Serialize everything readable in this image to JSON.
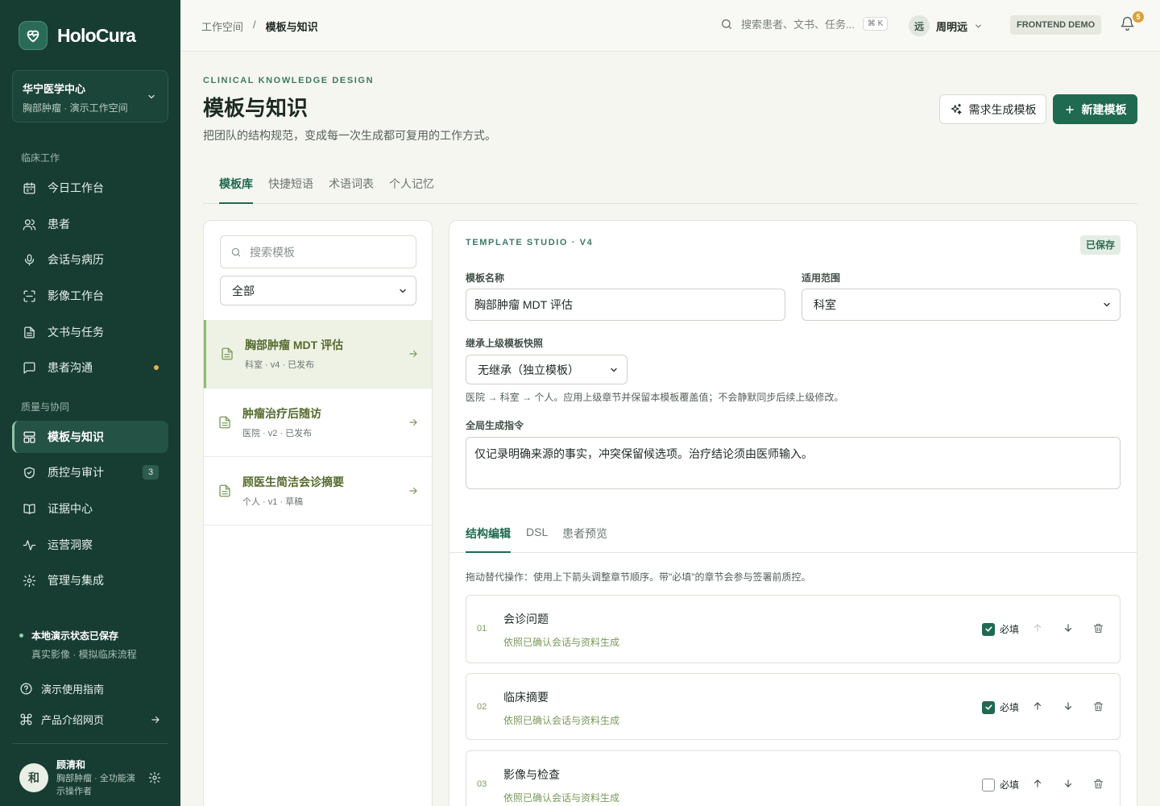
{
  "brand": {
    "name": "HoloCura"
  },
  "org": {
    "name": "华宁医学中心",
    "workspace": "胸部肿瘤 · 演示工作空间"
  },
  "nav": {
    "section_clinical": "临床工作",
    "section_quality": "质量与协同",
    "items": [
      {
        "label": "今日工作台",
        "icon": "calendar-icon"
      },
      {
        "label": "患者",
        "icon": "users-icon"
      },
      {
        "label": "会话与病历",
        "icon": "mic-icon"
      },
      {
        "label": "影像工作台",
        "icon": "scan-icon"
      },
      {
        "label": "文书与任务",
        "icon": "document-icon"
      },
      {
        "label": "患者沟通",
        "icon": "chat-icon",
        "dot": true
      },
      {
        "label": "模板与知识",
        "icon": "layout-icon",
        "active": true
      },
      {
        "label": "质控与审计",
        "icon": "shield-icon",
        "count": "3"
      },
      {
        "label": "证据中心",
        "icon": "book-icon"
      },
      {
        "label": "运营洞察",
        "icon": "activity-icon"
      },
      {
        "label": "管理与集成",
        "icon": "gear-icon"
      }
    ]
  },
  "status": {
    "title": "本地演示状态已保存",
    "sub": "真实影像 · 模拟临床流程"
  },
  "side_links": {
    "guide": "演示使用指南",
    "product": "产品介绍网页"
  },
  "user": {
    "initial": "和",
    "name": "顾清和",
    "role": "胸部肿瘤 · 全功能演示操作者"
  },
  "topbar": {
    "crumb_root": "工作空间",
    "crumb_sep": "/",
    "crumb_current": "模板与知识",
    "search_placeholder": "搜索患者、文书、任务...",
    "kbd": "⌘ K",
    "user_initial": "远",
    "user_name": "周明远",
    "demo_badge": "FRONTEND DEMO",
    "notif_count": "5"
  },
  "header": {
    "eyebrow": "CLINICAL KNOWLEDGE DESIGN",
    "title": "模板与知识",
    "subtitle": "把团队的结构规范，变成每一次生成都可复用的工作方式。",
    "btn_generate": "需求生成模板",
    "btn_new": "新建模板"
  },
  "tabs": [
    "模板库",
    "快捷短语",
    "术语词表",
    "个人记忆"
  ],
  "list": {
    "search_placeholder": "搜索模板",
    "filter_value": "全部",
    "items": [
      {
        "title": "胸部肿瘤 MDT 评估",
        "meta": "科室 · v4 · 已发布",
        "active": true
      },
      {
        "title": "肿瘤治疗后随访",
        "meta": "医院 · v2 · 已发布"
      },
      {
        "title": "顾医生简洁会诊摘要",
        "meta": "个人 · v1 · 草稿"
      }
    ]
  },
  "studio": {
    "eyebrow": "TEMPLATE STUDIO · V4",
    "saved": "已保存",
    "name_label": "模板名称",
    "name_value": "胸部肿瘤 MDT 评估",
    "scope_label": "适用范围",
    "scope_value": "科室",
    "inherit_label": "继承上级模板快照",
    "inherit_value": "无继承（独立模板）",
    "inherit_help": "医院 → 科室 → 个人。应用上级章节并保留本模板覆盖值；不会静默同步后续上级修改。",
    "instruction_label": "全局生成指令",
    "instruction_value": "仅记录明确来源的事实，冲突保留候选项。治疗结论须由医师输入。",
    "sub_tabs": [
      "结构编辑",
      "DSL",
      "患者预览"
    ],
    "drag_hint": "拖动替代操作：使用上下箭头调整章节顺序。带\"必填\"的章节会参与签署前质控。",
    "required_label": "必填",
    "sections": [
      {
        "num": "01",
        "title": "会诊问题",
        "sub": "依照已确认会话与资料生成",
        "required": true
      },
      {
        "num": "02",
        "title": "临床摘要",
        "sub": "依照已确认会话与资料生成",
        "required": true
      },
      {
        "num": "03",
        "title": "影像与检查",
        "sub": "依照已确认会话与资料生成",
        "required": false
      }
    ]
  }
}
